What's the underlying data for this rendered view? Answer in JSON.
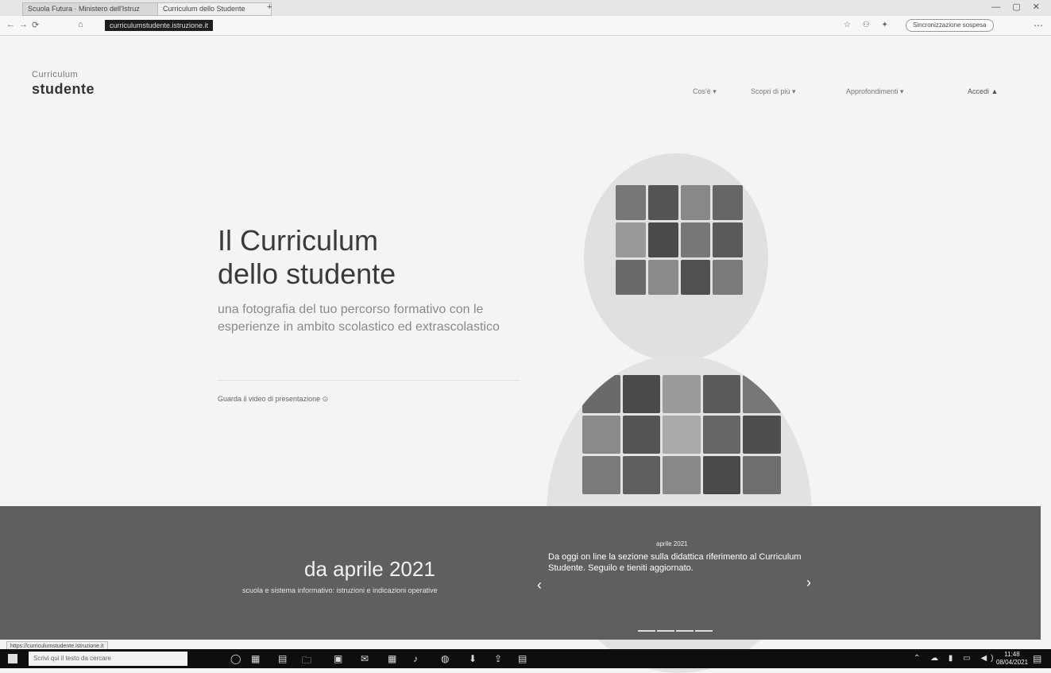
{
  "browser": {
    "tabs": [
      {
        "label": "Scuola Futura · Ministero dell'Istruz",
        "close": "×"
      },
      {
        "label": "Curriculum dello Studente",
        "close": "×"
      }
    ],
    "new_tab": "+",
    "window_controls": "— ▢ ✕",
    "back": "←",
    "forward": "→",
    "refresh": "⟳",
    "home": "⌂",
    "url": "curriculumstudente.istruzione.it",
    "addr_icons": "☆ ⚇ ✦",
    "sync_button": "Sincronizzazione sospesa",
    "menu": "⋯"
  },
  "site": {
    "logo_top": "Curriculum",
    "logo_bottom": "studente",
    "nav": [
      {
        "label": "Cos'è ▾"
      },
      {
        "label": "Scopri di più ▾"
      },
      {
        "label": "Approfondimenti ▾"
      },
      {
        "label": "Accedi ▲"
      }
    ]
  },
  "hero": {
    "title_line1": "Il Curriculum",
    "title_line2": "dello studente",
    "subtitle": "una fotografia del tuo percorso formativo con le esperienze in ambito scolastico ed extrascolastico",
    "link": "Guarda il video di presentazione ⊙"
  },
  "banner": {
    "title": "da aprile 2021",
    "subtitle": "scuola e sistema informativo: istruzioni e indicazioni operative",
    "news_date": "aprile 2021",
    "news_text": "Da oggi on line la sezione sulla didattica riferimento al Curriculum Studente. Seguilo e tieniti aggiornato.",
    "prev": "‹",
    "next": "›"
  },
  "status_tip": "https://curriculumstudente.istruzione.it",
  "taskbar": {
    "search_placeholder": "Scrivi qui il testo da cercare",
    "icons": [
      "◯",
      "▦",
      "▤",
      "🗀",
      "▣",
      "✉",
      "▦",
      "♪",
      "◍",
      "⬇",
      "⇪",
      "▤"
    ],
    "tray": "⌃ ☁ ▮ ▭ ◀)",
    "time": "11:48",
    "date": "08/04/2021",
    "notif": "▤"
  }
}
